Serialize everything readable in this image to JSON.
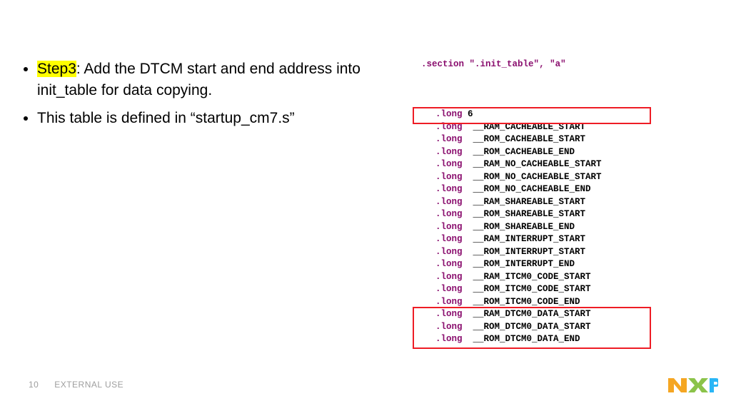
{
  "bullets": [
    {
      "step_label": "Step3",
      "rest": ": Add the DTCM start and end address into init_table for data copying."
    },
    {
      "step_label": "",
      "rest": "This table is defined in “startup_cm7.s”"
    }
  ],
  "code": {
    "section_dir": ".section",
    "section_name": "\".init_table\"",
    "section_flag": "\"a\"",
    "long_dir": ".long",
    "count": "6",
    "entries": [
      "__RAM_CACHEABLE_START",
      "__ROM_CACHEABLE_START",
      "__ROM_CACHEABLE_END",
      "__RAM_NO_CACHEABLE_START",
      "__ROM_NO_CACHEABLE_START",
      "__ROM_NO_CACHEABLE_END",
      "__RAM_SHAREABLE_START",
      "__ROM_SHAREABLE_START",
      "__ROM_SHAREABLE_END",
      "__RAM_INTERRUPT_START",
      "__ROM_INTERRUPT_START",
      "__ROM_INTERRUPT_END",
      "__RAM_ITCM0_CODE_START",
      "__ROM_ITCM0_CODE_START",
      "__ROM_ITCM0_CODE_END",
      "__RAM_DTCM0_DATA_START",
      "__ROM_DTCM0_DATA_START",
      "__ROM_DTCM0_DATA_END"
    ]
  },
  "footer": {
    "page": "10",
    "classification": "EXTERNAL USE"
  }
}
